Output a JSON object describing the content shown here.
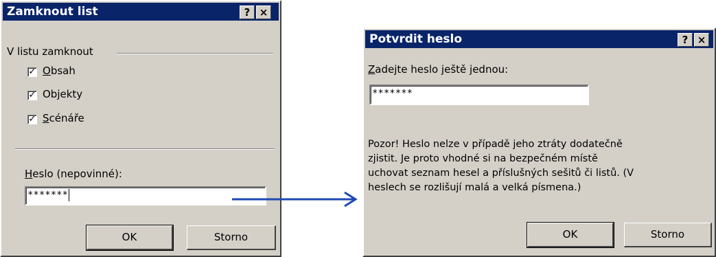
{
  "left_dialog": {
    "title": "Zamknout list",
    "help_btn": "?",
    "close_btn": "×",
    "group_label": "V listu zamknout",
    "checkboxes": [
      {
        "key": "O",
        "rest": "bsah",
        "prefix": "",
        "checked": true
      },
      {
        "key": "j",
        "rest": "ekty",
        "prefix": "Ob",
        "checked": true
      },
      {
        "key": "S",
        "rest": "cénáře",
        "prefix": "",
        "checked": true
      }
    ],
    "password_label_key": "H",
    "password_label_rest": "eslo (nepovinné):",
    "password_value": "*******",
    "ok_label": "OK",
    "cancel_label": "Storno"
  },
  "right_dialog": {
    "title": "Potvrdit heslo",
    "help_btn": "?",
    "close_btn": "×",
    "prompt_key": "Z",
    "prompt_rest": "adejte heslo ještě jednou:",
    "password_value": "*******",
    "warning_lines": [
      "Pozor!  Heslo nelze v případě jeho ztráty dodatečně",
      "zjistit. Je proto vhodné si na bezpečném místě",
      "uchovat seznam hesel a příslušných sešitů či listů. (V",
      "heslech se rozlišují malá a velká písmena.)"
    ],
    "ok_label": "OK",
    "cancel_label": "Storno"
  },
  "colors": {
    "titlebar": "#0a246a",
    "face": "#d4d0c8",
    "arrow": "#1e48b4"
  },
  "icons": {
    "check": "✓",
    "arrow": "arrow-right"
  }
}
